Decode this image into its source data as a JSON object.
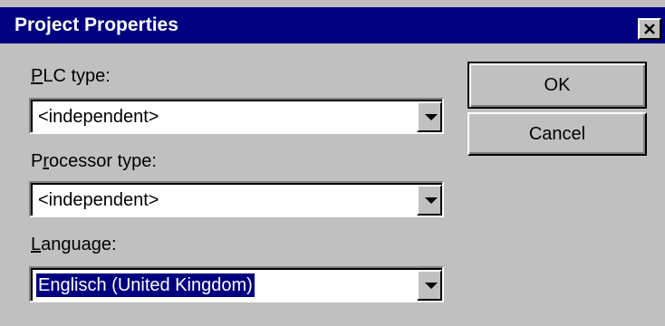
{
  "window": {
    "title": "Project Properties",
    "close_icon": "close-icon"
  },
  "form": {
    "plc_type": {
      "label_mnemonic": "P",
      "label_rest": "LC type:",
      "value": "<independent>"
    },
    "processor_type": {
      "label_mnemonic": "r",
      "label_prefix": "P",
      "label_rest": "ocessor type:",
      "value": "<independent>"
    },
    "language": {
      "label_mnemonic": "L",
      "label_rest": "anguage:",
      "value": "Englisch (United Kingdom)"
    }
  },
  "buttons": {
    "ok_label": "OK",
    "cancel_label": "Cancel"
  },
  "colors": {
    "title_bar": "#000080",
    "face": "#c0c0c0",
    "selection": "#000080"
  }
}
